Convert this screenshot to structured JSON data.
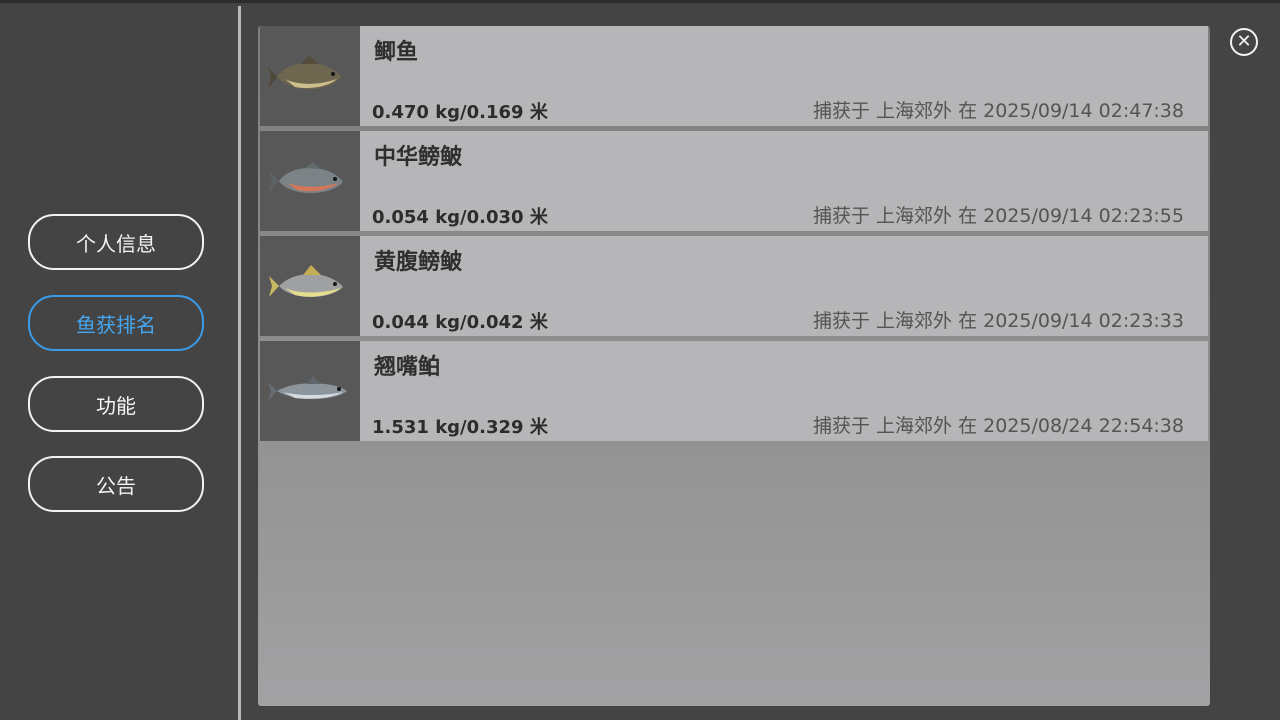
{
  "menu": {
    "items": [
      {
        "label": "个人信息",
        "active": false
      },
      {
        "label": "鱼获排名",
        "active": true
      },
      {
        "label": "功能",
        "active": false
      },
      {
        "label": "公告",
        "active": false
      }
    ]
  },
  "close_icon": "close-circle-icon",
  "catches": [
    {
      "name": "鲫鱼",
      "stats": "0.470 kg/0.169 米",
      "caught": "捕获于 上海郊外 在 2025/09/14 02:47:38",
      "icon": "crucian-carp-icon"
    },
    {
      "name": "中华鳑鲏",
      "stats": "0.054 kg/0.030 米",
      "caught": "捕获于 上海郊外 在 2025/09/14 02:23:55",
      "icon": "chinese-bitterling-icon"
    },
    {
      "name": "黄腹鳑鲏",
      "stats": "0.044 kg/0.042 米",
      "caught": "捕获于 上海郊外 在 2025/09/14 02:23:33",
      "icon": "yellow-belly-bitterling-icon"
    },
    {
      "name": "翘嘴鲌",
      "stats": "1.531 kg/0.329 米",
      "caught": "捕获于 上海郊外 在 2025/08/24 22:54:38",
      "icon": "topmouth-culter-icon"
    }
  ],
  "colors": {
    "accent": "#45a6f0",
    "background": "#444444",
    "row": "#b6b5b8"
  }
}
